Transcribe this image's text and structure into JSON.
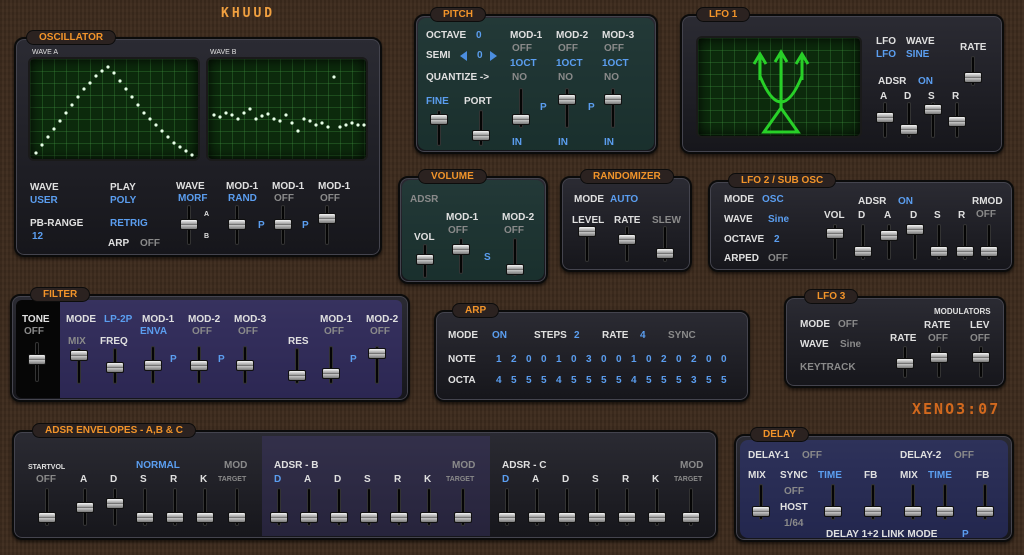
{
  "logo": "KHUUD",
  "logo2": "XENO3:07",
  "osc": {
    "title": "OSCILLATOR",
    "wave_a": "WAVE A",
    "wave_b": "WAVE B",
    "wave_lbl": "WAVE",
    "wave_val": "USER",
    "play_lbl": "PLAY",
    "play_val": "POLY",
    "pb_lbl": "PB-RANGE",
    "pb_val": "12",
    "retrig": "RETRIG",
    "arp_lbl": "ARP",
    "arp_val": "OFF",
    "wave2_lbl": "WAVE",
    "wave2_val": "MORF",
    "mod1a_lbl": "MOD-1",
    "mod1a_val": "RAND",
    "mod1b_lbl": "MOD-1",
    "mod1b_val": "OFF",
    "mod1c_lbl": "MOD-1",
    "mod1c_val": "OFF",
    "a": "A",
    "bb": "B",
    "p1": "P",
    "p2": "P"
  },
  "pitch": {
    "title": "PITCH",
    "octave_lbl": "OCTAVE",
    "octave_val": "0",
    "semi_lbl": "SEMI",
    "semi_val": "0",
    "quant": "QUANTIZE ->",
    "fine": "FINE",
    "port": "PORT",
    "m1": "MOD-1",
    "m2": "MOD-2",
    "m3": "MOD-3",
    "off": "OFF",
    "oct": "1OCT",
    "no": "NO",
    "in": "IN",
    "p": "P"
  },
  "lfo1": {
    "title": "LFO 1",
    "lfo": "LFO",
    "wave": "WAVE",
    "lfo_val": "LFO",
    "wave_val": "SINE",
    "rate": "RATE",
    "adsr": "ADSR",
    "adsr_val": "ON",
    "a": "A",
    "d": "D",
    "s": "S",
    "r": "R"
  },
  "volume": {
    "title": "VOLUME",
    "adsr": "ADSR",
    "mod1": "MOD-1",
    "mod2": "MOD-2",
    "vol": "VOL",
    "off": "OFF",
    "s": "S"
  },
  "rand": {
    "title": "RANDOMIZER",
    "mode": "MODE",
    "mode_val": "AUTO",
    "level": "LEVEL",
    "rate": "RATE",
    "slew": "SLEW"
  },
  "lfo2": {
    "title": "LFO 2 / SUB OSC",
    "mode": "MODE",
    "mode_val": "OSC",
    "adsr": "ADSR",
    "adsr_val": "ON",
    "rmod": "RMOD",
    "rmod_val": "OFF",
    "wave": "WAVE",
    "wave_val": "Sine",
    "octave": "OCTAVE",
    "octave_val": "2",
    "arped": "ARPED",
    "arped_val": "OFF",
    "vol": "VOL",
    "d": "D",
    "a": "A",
    "d2": "D",
    "s": "S",
    "r": "R"
  },
  "filter": {
    "title": "FILTER",
    "tone": "TONE",
    "tone_val": "OFF",
    "mode": "MODE",
    "mode_val": "LP-2P",
    "mix": "MIX",
    "freq": "FREQ",
    "m1": "MOD-1",
    "m1_val": "ENVA",
    "m2": "MOD-2",
    "m3": "MOD-3",
    "off": "OFF",
    "p": "P",
    "res": "RES"
  },
  "arp": {
    "title": "ARP",
    "mode": "MODE",
    "mode_val": "ON",
    "steps": "STEPS",
    "steps_val": "2",
    "rate": "RATE",
    "rate_val": "4",
    "sync": "SYNC",
    "note": "NOTE",
    "octa": "OCTA",
    "notes": [
      "1",
      "2",
      "0",
      "0",
      "1",
      "0",
      "3",
      "0",
      "0",
      "1",
      "0",
      "2",
      "0",
      "2",
      "0",
      "0"
    ],
    "octas": [
      "4",
      "5",
      "5",
      "5",
      "4",
      "5",
      "5",
      "5",
      "5",
      "4",
      "5",
      "5",
      "5",
      "3",
      "5",
      "5"
    ]
  },
  "lfo3": {
    "title": "LFO 3",
    "modulators": "MODULATORS",
    "mode": "MODE",
    "mode_val": "OFF",
    "wave": "WAVE",
    "wave_val": "Sine",
    "keytrack": "KEYTRACK",
    "rate": "RATE",
    "rate2": "RATE",
    "rate2_val": "OFF",
    "lev": "LEV",
    "lev_val": "OFF"
  },
  "adsr": {
    "title": "ADSR ENVELOPES - A,B & C",
    "startvol": "STARTVOL",
    "off": "OFF",
    "normal": "NORMAL",
    "mod": "MOD",
    "target": "TARGET",
    "adsr_b": "ADSR - B",
    "adsr_c": "ADSR - C",
    "labels_a": [
      "A",
      "D",
      "S",
      "R",
      "K"
    ],
    "labels_b": [
      "D",
      "A",
      "D",
      "S",
      "R",
      "K"
    ],
    "labels_c": [
      "D",
      "A",
      "D",
      "S",
      "R",
      "K"
    ]
  },
  "delay": {
    "title": "DELAY",
    "d1": "DELAY-1",
    "d1_val": "OFF",
    "d2": "DELAY-2",
    "d2_val": "OFF",
    "mix": "MIX",
    "sync": "SYNC",
    "sync_val": "OFF",
    "host": "HOST",
    "div": "1/64",
    "time": "TIME",
    "fb": "FB",
    "link": "DELAY 1+2 LINK MODE",
    "link_val": "P"
  }
}
